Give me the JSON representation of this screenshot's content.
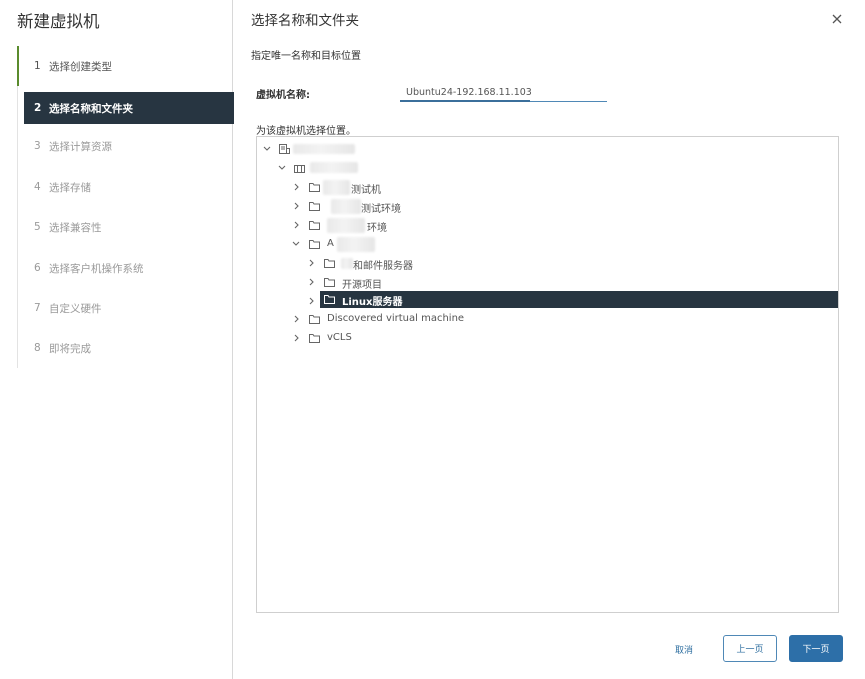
{
  "wizard": {
    "title": "新建虚拟机",
    "steps": [
      {
        "num": "1",
        "label": "选择创建类型",
        "state": "done"
      },
      {
        "num": "2",
        "label": "选择名称和文件夹",
        "state": "active"
      },
      {
        "num": "3",
        "label": "选择计算资源",
        "state": "pending"
      },
      {
        "num": "4",
        "label": "选择存储",
        "state": "pending"
      },
      {
        "num": "5",
        "label": "选择兼容性",
        "state": "pending"
      },
      {
        "num": "6",
        "label": "选择客户机操作系统",
        "state": "pending"
      },
      {
        "num": "7",
        "label": "自定义硬件",
        "state": "pending"
      },
      {
        "num": "8",
        "label": "即将完成",
        "state": "pending"
      }
    ]
  },
  "main": {
    "title": "选择名称和文件夹",
    "subtitle": "指定唯一名称和目标位置",
    "vm_name_label": "虚拟机名称:",
    "vm_name_value": "Ubuntu24-192.168.11.103",
    "location_label": "为该虚拟机选择位置。"
  },
  "tree": {
    "nodes": [
      {
        "label": "",
        "icon": "vcenter-icon",
        "expanded": true,
        "redacted": true
      },
      {
        "label": "",
        "icon": "datacenter-icon",
        "expanded": true,
        "redacted": true
      },
      {
        "label": "测试机",
        "icon": "folder-icon",
        "expanded": false,
        "partially_redacted": true
      },
      {
        "label": "测试环境",
        "icon": "folder-icon",
        "expanded": false,
        "partially_redacted": true
      },
      {
        "label": "环境",
        "icon": "folder-icon",
        "expanded": false,
        "partially_redacted": true
      },
      {
        "label": "A",
        "icon": "folder-icon",
        "expanded": true,
        "partially_redacted": true
      },
      {
        "label": "和邮件服务器",
        "icon": "folder-icon",
        "expanded": false,
        "partially_redacted": true
      },
      {
        "label": "开源项目",
        "icon": "folder-icon",
        "expanded": false
      },
      {
        "label": "Linux服务器",
        "icon": "folder-icon",
        "expanded": false,
        "selected": true
      },
      {
        "label": "Discovered virtual machine",
        "icon": "folder-icon",
        "expanded": false
      },
      {
        "label": "vCLS",
        "icon": "folder-icon",
        "expanded": false
      }
    ]
  },
  "footer": {
    "cancel_label": "取消",
    "prev_label": "上一页",
    "next_label": "下一页"
  },
  "colors": {
    "active_step_bg": "#273541",
    "done_step_border": "#5a8b2d",
    "primary_button": "#2d6fa8",
    "link_text": "#2f6fa0"
  }
}
